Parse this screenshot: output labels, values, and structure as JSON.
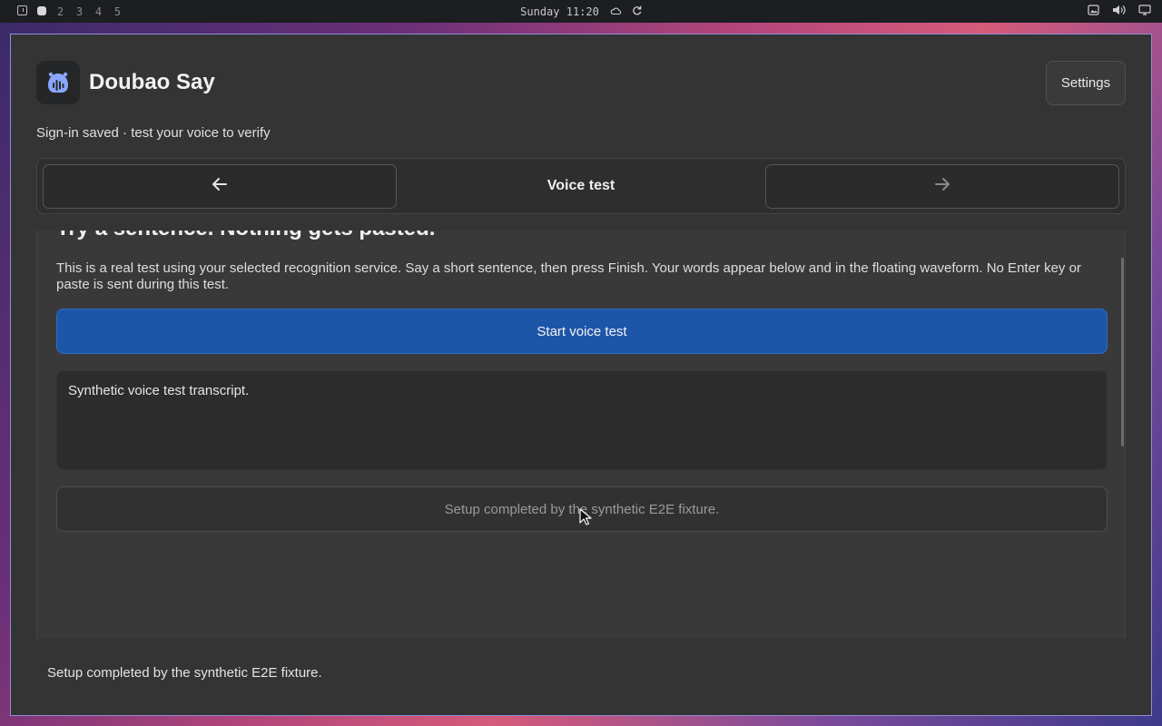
{
  "topbar": {
    "workspaces": [
      "2",
      "3",
      "4",
      "5"
    ],
    "clock": "Sunday 11:20",
    "icons": [
      "layout-icon",
      "workspace-active-icon",
      "cloud-icon",
      "refresh-icon",
      "screenshot-icon",
      "volume-icon",
      "display-icon"
    ]
  },
  "app": {
    "title": "Doubao Say",
    "settings_label": "Settings",
    "subtitle": "Sign-in saved · test your voice to verify"
  },
  "nav": {
    "back_icon": "←",
    "next_icon": "→",
    "step_title": "Voice test"
  },
  "panel": {
    "heading": "Try a sentence. Nothing gets pasted.",
    "description": "This is a real test using your selected recognition service. Say a short sentence, then press Finish. Your words appear below and in the floating waveform. No Enter key or paste is sent during this test.",
    "start_label": "Start voice test",
    "transcript": "Synthetic voice test transcript.",
    "status": "Setup completed by the synthetic E2E fixture."
  },
  "footer": {
    "status": "Setup completed by the synthetic E2E fixture."
  },
  "colors": {
    "accent_button": "#1d56a8",
    "window_bg": "#343434",
    "window_border": "#8e8fd8",
    "logo_icon": "#8aa7ff"
  }
}
